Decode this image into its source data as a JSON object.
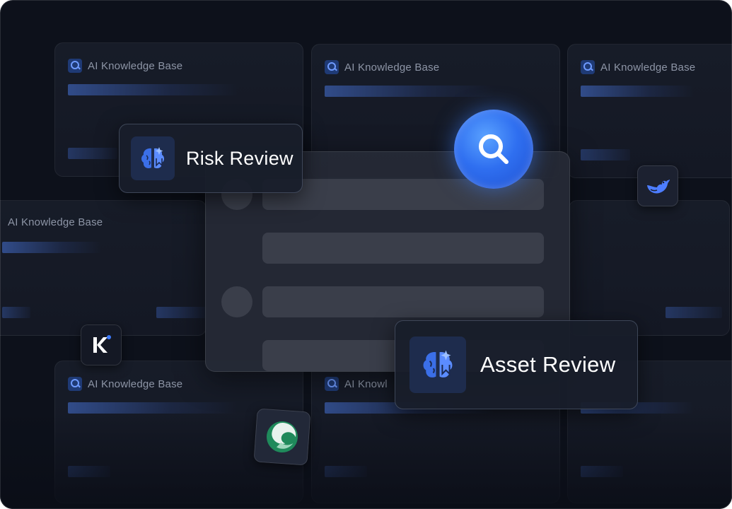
{
  "background_cards": {
    "title": "AI Knowledge Base",
    "truncated_title": "AI Knowl"
  },
  "risk_review": {
    "title": "Risk Review",
    "icon": "brain-icon"
  },
  "asset_review": {
    "title": "Asset Review",
    "icon": "brain-icon"
  },
  "search": {
    "icon": "search-icon"
  },
  "apps": [
    {
      "icon": "deepseek-whale-icon"
    },
    {
      "icon": "kimi-k-icon"
    },
    {
      "icon": "green-swirl-logo-icon"
    }
  ],
  "colors": {
    "background": "#0d111b",
    "accent": "#2f6ff0",
    "icon_blue": "#4d86ff"
  }
}
